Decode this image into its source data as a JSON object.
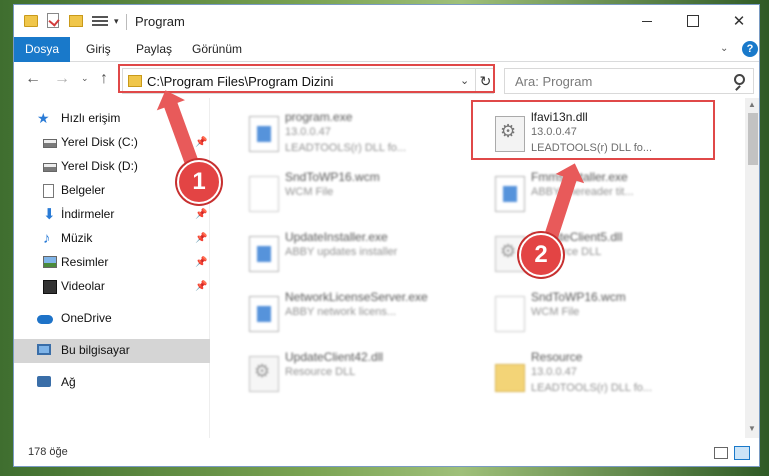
{
  "window": {
    "title": "Program",
    "controls": {
      "minimize": "",
      "maximize": "",
      "close": "✕"
    }
  },
  "ribbon": {
    "tabs": [
      "Dosya",
      "Giriş",
      "Paylaş",
      "Görünüm"
    ],
    "expand_glyph": "⌄",
    "help_glyph": "?"
  },
  "navigation": {
    "back": "←",
    "forward": "→",
    "recent": "⌄",
    "up": "↑",
    "address": "C:\\Program Files\\Program Dizini",
    "address_dropdown": "⌄",
    "refresh": "↻",
    "search_placeholder": "Ara: Program"
  },
  "sidebar": {
    "items": [
      {
        "label": "Hızlı erişim",
        "icon": "star-icon",
        "pinned": false
      },
      {
        "label": "Yerel Disk (C:)",
        "icon": "drive-icon",
        "pinned": true
      },
      {
        "label": "Yerel Disk (D:)",
        "icon": "drive-icon",
        "pinned": true
      },
      {
        "label": "Belgeler",
        "icon": "documents-icon",
        "pinned": true
      },
      {
        "label": "İndirmeler",
        "icon": "downloads-icon",
        "pinned": true
      },
      {
        "label": "Müzik",
        "icon": "music-icon",
        "pinned": true
      },
      {
        "label": "Resimler",
        "icon": "pictures-icon",
        "pinned": true
      },
      {
        "label": "Videolar",
        "icon": "videos-icon",
        "pinned": true
      },
      {
        "label": "OneDrive",
        "icon": "onedrive-icon",
        "pinned": false
      },
      {
        "label": "Bu bilgisayar",
        "icon": "computer-icon",
        "pinned": false,
        "selected": true
      },
      {
        "label": "Ağ",
        "icon": "network-icon",
        "pinned": false
      }
    ],
    "pin_glyph": "📌",
    "star_glyph": "★",
    "download_glyph": "⬇",
    "music_glyph": "♪"
  },
  "files": [
    {
      "name": "program.exe",
      "line2": "13.0.0.47",
      "line3": "LEADTOOLS(r) DLL fo...",
      "icon": "exe-icon",
      "blurred": true
    },
    {
      "name": "lfavi13n.dll",
      "line2": "13.0.0.47",
      "line3": "LEADTOOLS(r) DLL fo...",
      "icon": "dll-icon",
      "blurred": false,
      "highlighted": true
    },
    {
      "name": "SndToWP16.wcm",
      "line2": "WCM File",
      "line3": "",
      "icon": "document-icon",
      "blurred": true
    },
    {
      "name": "Fmmsinstaller.exe",
      "line2": "ABBY finereader tit...",
      "line3": "",
      "icon": "exe-icon",
      "blurred": true
    },
    {
      "name": "UpdateInstaller.exe",
      "line2": "ABBY updates installer",
      "line3": "",
      "icon": "exe-icon",
      "blurred": true
    },
    {
      "name": "UpdateClient5.dll",
      "line2": "Resource DLL",
      "line3": "",
      "icon": "dll-icon",
      "blurred": true
    },
    {
      "name": "NetworkLicenseServer.exe",
      "line2": "ABBY network licens...",
      "line3": "",
      "icon": "exe-icon",
      "blurred": true
    },
    {
      "name": "SndToWP16.wcm",
      "line2": "WCM File",
      "line3": "",
      "icon": "document-icon",
      "blurred": true
    },
    {
      "name": "UpdateClient42.dll",
      "line2": "Resource DLL",
      "line3": "",
      "icon": "dll-icon",
      "blurred": true
    },
    {
      "name": "Resource",
      "line2": "13.0.0.47",
      "line3": "LEADTOOLS(r) DLL fo...",
      "icon": "folder-icon",
      "blurred": true
    }
  ],
  "status": {
    "item_count": "178 öğe"
  },
  "callouts": [
    {
      "number": "1"
    },
    {
      "number": "2"
    }
  ],
  "colors": {
    "accent": "#1979ca",
    "highlight_border": "#e04848",
    "callout": "#e34444"
  }
}
